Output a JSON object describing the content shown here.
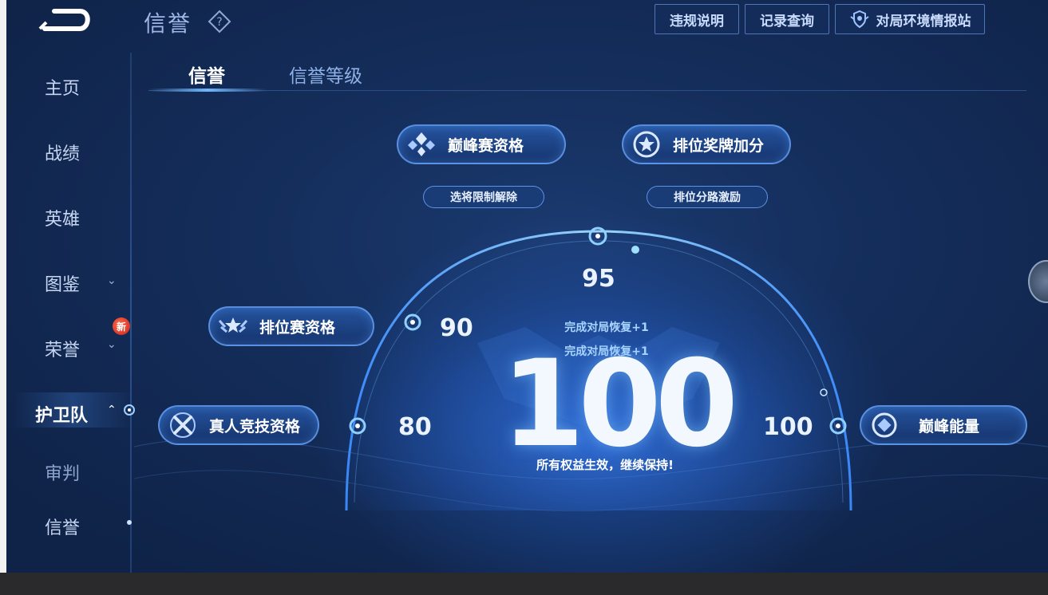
{
  "header": {
    "title": "信誉",
    "buttons": [
      {
        "label": "违规说明"
      },
      {
        "label": "记录查询"
      },
      {
        "label": "对局环境情报站"
      }
    ]
  },
  "sidebar": {
    "items": [
      {
        "label": "主页"
      },
      {
        "label": "战绩"
      },
      {
        "label": "英雄"
      },
      {
        "label": "图鉴"
      },
      {
        "label": "荣誉",
        "badge": "新"
      },
      {
        "label": "护卫队"
      },
      {
        "label": "审判"
      },
      {
        "label": "信誉"
      }
    ]
  },
  "tabs": [
    {
      "label": "信誉"
    },
    {
      "label": "信誉等级"
    }
  ],
  "perks": {
    "peak_match": {
      "label": "巅峰赛资格",
      "sub": "选将限制解除"
    },
    "rank_medal": {
      "label": "排位奖牌加分",
      "sub": "排位分路激励"
    },
    "ranked": {
      "label": "排位赛资格"
    },
    "real_player": {
      "label": "真人竞技资格"
    },
    "peak_energy": {
      "label": "巅峰能量"
    }
  },
  "scale": {
    "t80": "80",
    "t90": "90",
    "t95": "95",
    "t100": "100"
  },
  "score": {
    "value": "100",
    "recover_1": "完成对局恢复+1",
    "recover_2": "完成对局恢复+1",
    "status": "所有权益生效，继续保持!"
  },
  "colors": {
    "accent": "#6fb8ff",
    "background": "#142d5a"
  }
}
